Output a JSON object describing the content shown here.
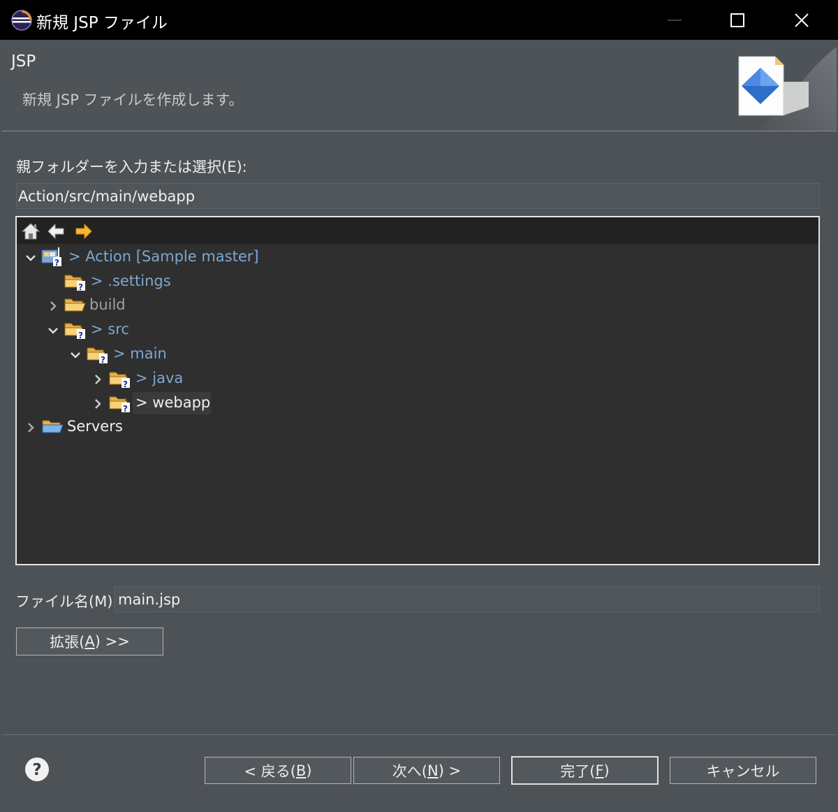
{
  "window": {
    "title": "新規 JSP ファイル"
  },
  "banner": {
    "title": "JSP",
    "description": "新規 JSP ファイルを作成します。"
  },
  "folder": {
    "label": "親フォルダーを入力または選択(E):",
    "value": "Action/src/main/webapp"
  },
  "tree": {
    "toolbar": [
      "home-icon",
      "back-arrow-icon",
      "forward-arrow-icon"
    ],
    "items": [
      {
        "label": "> Action [Sample master]",
        "expanded": true,
        "color": "#7da7d1"
      },
      {
        "label": "> .settings",
        "color": "#7da7d1"
      },
      {
        "label": "build",
        "expanded": false,
        "color": "#a0a0a0"
      },
      {
        "label": "> src",
        "expanded": true,
        "color": "#7da7d1"
      },
      {
        "label": "> main",
        "expanded": true,
        "color": "#7da7d1"
      },
      {
        "label": "> java",
        "expanded": false,
        "color": "#7da7d1"
      },
      {
        "label": "> webapp",
        "expanded": false,
        "selected": true,
        "color": "#f0f0f0"
      },
      {
        "label": "Servers",
        "expanded": false,
        "color": "#f0f0f0"
      }
    ]
  },
  "file": {
    "label": "ファイル名(M):",
    "value": "main.jsp"
  },
  "buttons": {
    "advanced_pre": "拡張(",
    "advanced_key": "A",
    "advanced_post": ") >>",
    "back_pre": "< 戻る(",
    "back_key": "B",
    "back_post": ")",
    "next_pre": "次へ(",
    "next_key": "N",
    "next_post": ") >",
    "finish_pre": "完了(",
    "finish_key": "F",
    "finish_post": ")",
    "cancel": "キャンセル"
  }
}
